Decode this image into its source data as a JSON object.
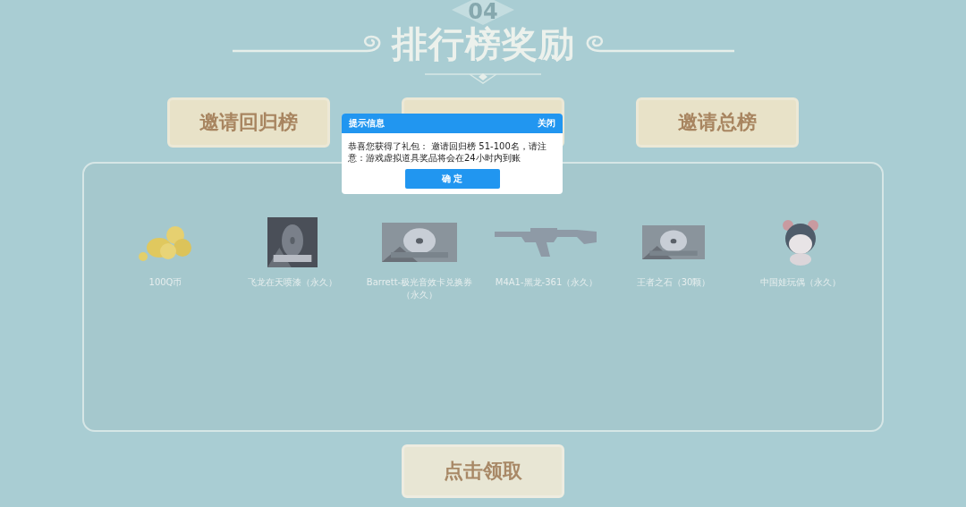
{
  "header": {
    "number": "04",
    "title": "排行榜奖励"
  },
  "tabs": [
    {
      "kind": "text",
      "label": "邀请回归榜"
    },
    {
      "kind": "covered"
    },
    {
      "kind": "text",
      "label": "邀请总榜"
    }
  ],
  "rewards": [
    {
      "kind": "coins",
      "label": "100Q币"
    },
    {
      "kind": "picture",
      "label": "飞龙在天喷漆（永久）"
    },
    {
      "kind": "picture",
      "label": "Barrett-极光音效卡兑换券（永久）"
    },
    {
      "kind": "rifle",
      "label": "M4A1-黑龙-361（永久）"
    },
    {
      "kind": "picture",
      "label": "王者之石（30颗）"
    },
    {
      "kind": "doll",
      "label": "中国娃玩偶（永久）"
    }
  ],
  "claim_button": "点击领取",
  "dialog": {
    "title": "提示信息",
    "close": "关闭",
    "message": "恭喜您获得了礼包： 邀请回归榜 51-100名，请注意：游戏虚拟道具奖品将会在24小时内到账",
    "confirm": "确 定"
  }
}
